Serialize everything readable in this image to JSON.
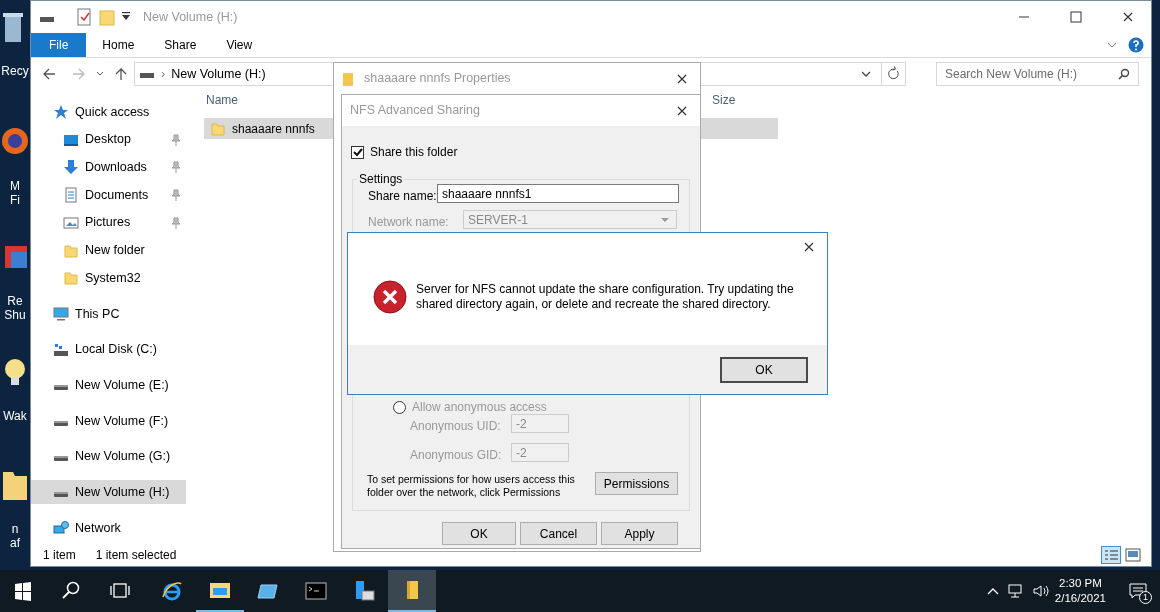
{
  "desktop": {
    "icons": [
      {
        "kind": "bin",
        "lines": [
          "Recy"
        ]
      },
      {
        "kind": "browser",
        "lines": [
          "M",
          "Fi"
        ]
      },
      {
        "kind": "app",
        "lines": [
          "Re",
          "Shu"
        ]
      },
      {
        "kind": "bulb",
        "lines": [
          "Wak"
        ]
      },
      {
        "kind": "folder",
        "lines": [
          "n",
          "af"
        ]
      }
    ]
  },
  "explorer": {
    "title": "New Volume (H:)",
    "ribbon_tabs": [
      {
        "label": "File",
        "kind": "file"
      },
      {
        "label": "Home",
        "kind": "tab"
      },
      {
        "label": "Share",
        "kind": "tab"
      },
      {
        "label": "View",
        "kind": "tab"
      }
    ],
    "address_separator": "›",
    "address": "New Volume (H:)",
    "search": {
      "placeholder": "Search New Volume (H:)"
    },
    "nav": [
      {
        "label": "Quick access",
        "kind": "star",
        "selected": false,
        "children": [
          {
            "label": "Desktop",
            "kind": "desktop",
            "pinned": true,
            "selected": false
          },
          {
            "label": "Downloads",
            "kind": "download",
            "pinned": true,
            "selected": false
          },
          {
            "label": "Documents",
            "kind": "document",
            "pinned": true,
            "selected": false
          },
          {
            "label": "Pictures",
            "kind": "picture",
            "pinned": true,
            "selected": false
          },
          {
            "label": "New folder",
            "kind": "folder",
            "pinned": false,
            "selected": false
          },
          {
            "label": "System32",
            "kind": "folder",
            "pinned": false,
            "selected": false
          }
        ]
      },
      {
        "label": "This PC",
        "kind": "pc",
        "selected": false,
        "children": [
          {
            "label": "Local Disk (C:)",
            "kind": "disk",
            "selected": false
          },
          {
            "label": "New Volume (E:)",
            "kind": "drive",
            "selected": false
          },
          {
            "label": "New Volume (F:)",
            "kind": "drive",
            "selected": false
          },
          {
            "label": "New Volume (G:)",
            "kind": "drive",
            "selected": false
          },
          {
            "label": "New Volume (H:)",
            "kind": "drive",
            "selected": true
          }
        ]
      },
      {
        "label": "Network",
        "kind": "network",
        "selected": false
      }
    ],
    "columns": [
      "Name",
      "Size"
    ],
    "files": [
      {
        "name": "shaaaare nnnfs",
        "selected": true
      }
    ],
    "status": {
      "count": "1 item",
      "selection": "1 item selected"
    }
  },
  "properties_dialog": {
    "title": "shaaaare nnnfs Properties"
  },
  "nfs_dialog": {
    "title": "NFS Advanced Sharing",
    "share_folder": {
      "label": "Share this folder",
      "checked": true
    },
    "settings_label": "Settings",
    "share_name": {
      "label": "Share name:",
      "value": "shaaaare nnnfs1"
    },
    "network_name": {
      "label": "Network name:",
      "value": "SERVER-1",
      "disabled": true
    },
    "anonymous": {
      "label": "Allow anonymous access",
      "checked": false
    },
    "uid": {
      "label": "Anonymous UID:",
      "value": "-2",
      "disabled": true
    },
    "gid": {
      "label": "Anonymous GID:",
      "value": "-2",
      "disabled": true
    },
    "permissions_text": "To set permissions for how users access this folder over the network, click Permissions",
    "permissions_button": "Permissions",
    "buttons": [
      "OK",
      "Cancel",
      "Apply"
    ]
  },
  "error_dialog": {
    "message": "Server for NFS cannot update the share configuration. Try updating the shared directory again, or delete and recreate the shared directory.",
    "button": "OK"
  },
  "taskbar": {
    "apps": [
      {
        "kind": "start",
        "running": false,
        "selected": false
      },
      {
        "kind": "search",
        "running": false,
        "selected": false
      },
      {
        "kind": "taskview",
        "running": false,
        "selected": false
      },
      {
        "kind": "ie",
        "running": false,
        "selected": false
      },
      {
        "kind": "explorer",
        "running": true,
        "selected": false
      },
      {
        "kind": "manager",
        "running": false,
        "selected": false
      },
      {
        "kind": "cmd",
        "running": false,
        "selected": false
      },
      {
        "kind": "server",
        "running": false,
        "selected": false
      },
      {
        "kind": "folder",
        "running": true,
        "selected": true
      }
    ],
    "clock": {
      "time": "2:30 PM",
      "date": "2/16/2021"
    },
    "notification_count": "1"
  }
}
